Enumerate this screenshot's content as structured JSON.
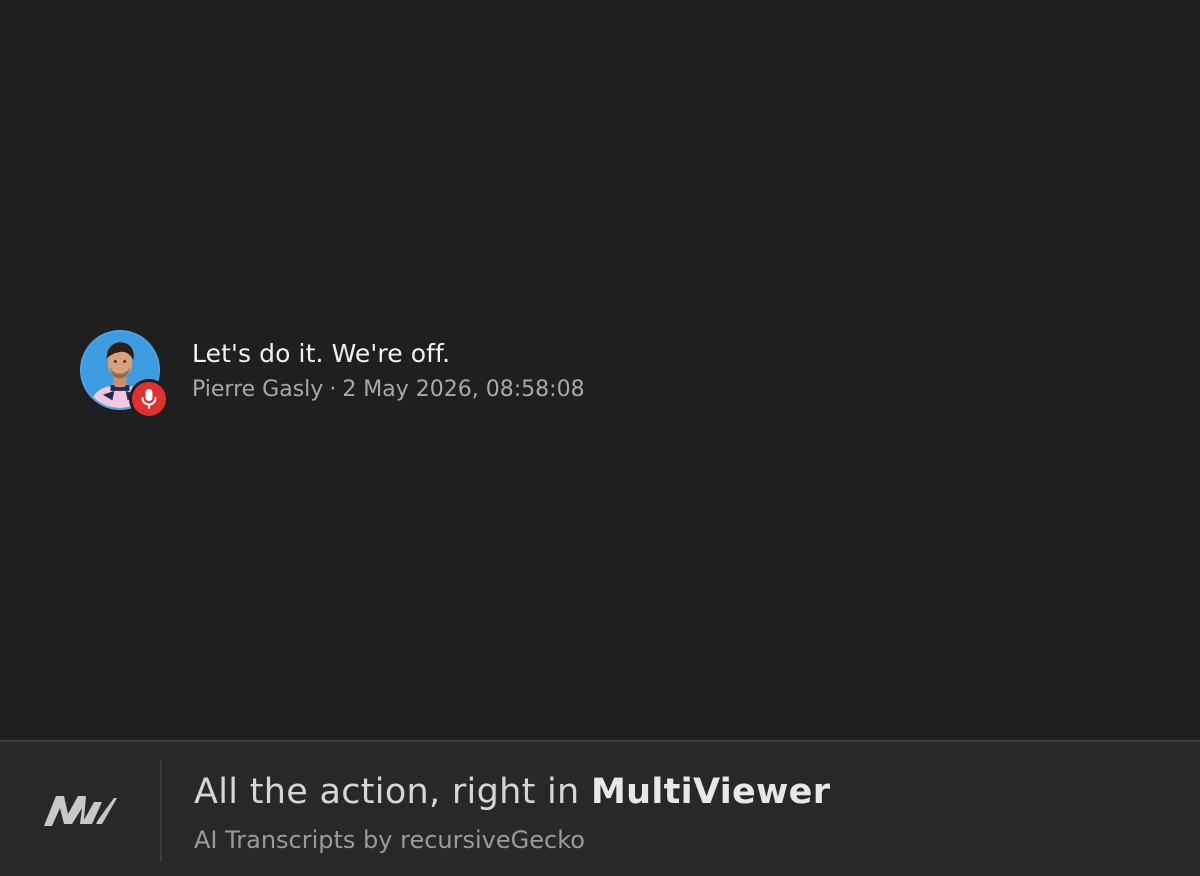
{
  "message": {
    "text": "Let's do it. We're off.",
    "speaker": "Pierre Gasly",
    "separator": "·",
    "timestamp": "2 May 2026, 08:58:08",
    "avatar_icon": "driver-avatar-icon",
    "badge_icon": "microphone-icon",
    "badge_color": "#e13030",
    "avatar_bg_color": "#3d9be0"
  },
  "footer": {
    "logo_icon": "multiviewer-logo-icon",
    "tagline_prefix": "All the action, right in ",
    "tagline_brand": "MultiViewer",
    "credit": "AI Transcripts by recursiveGecko"
  },
  "colors": {
    "background": "#1f1f1f",
    "footer_background": "#282828",
    "text_primary": "#f2f2f2",
    "text_secondary": "#a8a8a8"
  }
}
